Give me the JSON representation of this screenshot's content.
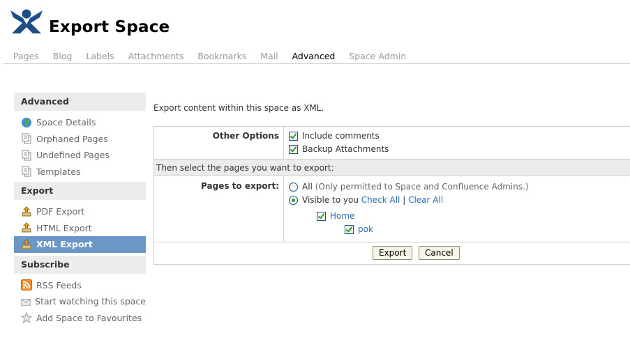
{
  "header": {
    "title": "Export Space"
  },
  "tabs": [
    {
      "label": "Pages"
    },
    {
      "label": "Blog"
    },
    {
      "label": "Labels"
    },
    {
      "label": "Attachments"
    },
    {
      "label": "Bookmarks"
    },
    {
      "label": "Mail"
    },
    {
      "label": "Advanced",
      "active": true
    },
    {
      "label": "Space Admin"
    }
  ],
  "sidebar": {
    "advanced": {
      "heading": "Advanced",
      "items": [
        {
          "label": "Space Details",
          "icon": "globe-icon"
        },
        {
          "label": "Orphaned Pages",
          "icon": "pages-icon"
        },
        {
          "label": "Undefined Pages",
          "icon": "pages-icon"
        },
        {
          "label": "Templates",
          "icon": "pages-icon"
        }
      ]
    },
    "export": {
      "heading": "Export",
      "items": [
        {
          "label": "PDF Export",
          "icon": "export-icon"
        },
        {
          "label": "HTML Export",
          "icon": "export-icon"
        },
        {
          "label": "XML Export",
          "icon": "export-icon",
          "active": true
        }
      ]
    },
    "subscribe": {
      "heading": "Subscribe",
      "items": [
        {
          "label": "RSS Feeds",
          "icon": "rss-icon"
        },
        {
          "label": "Start watching this space",
          "icon": "envelope-icon"
        },
        {
          "label": "Add Space to Favourites",
          "icon": "star-icon"
        }
      ]
    }
  },
  "main": {
    "intro": "Export content within this space as XML.",
    "other_options_label": "Other Options",
    "include_comments": "Include comments",
    "backup_attachments": "Backup Attachments",
    "select_pages_text": "Then select the pages you want to export:",
    "pages_to_export_label": "Pages to export:",
    "all_label": "All",
    "all_note": "(Only permitted to Space and Confluence Admins.)",
    "visible_label": "Visible to you",
    "check_all": "Check All",
    "separator": "|",
    "clear_all": "Clear All",
    "tree": [
      {
        "label": "Home"
      },
      {
        "label": "pok"
      }
    ],
    "export_button": "Export",
    "cancel_button": "Cancel"
  },
  "colors": {
    "active_bg": "#6b97c7",
    "link": "#2b6bb0",
    "checkmark": "#2a9a2a",
    "logo": "#1d4f86"
  }
}
